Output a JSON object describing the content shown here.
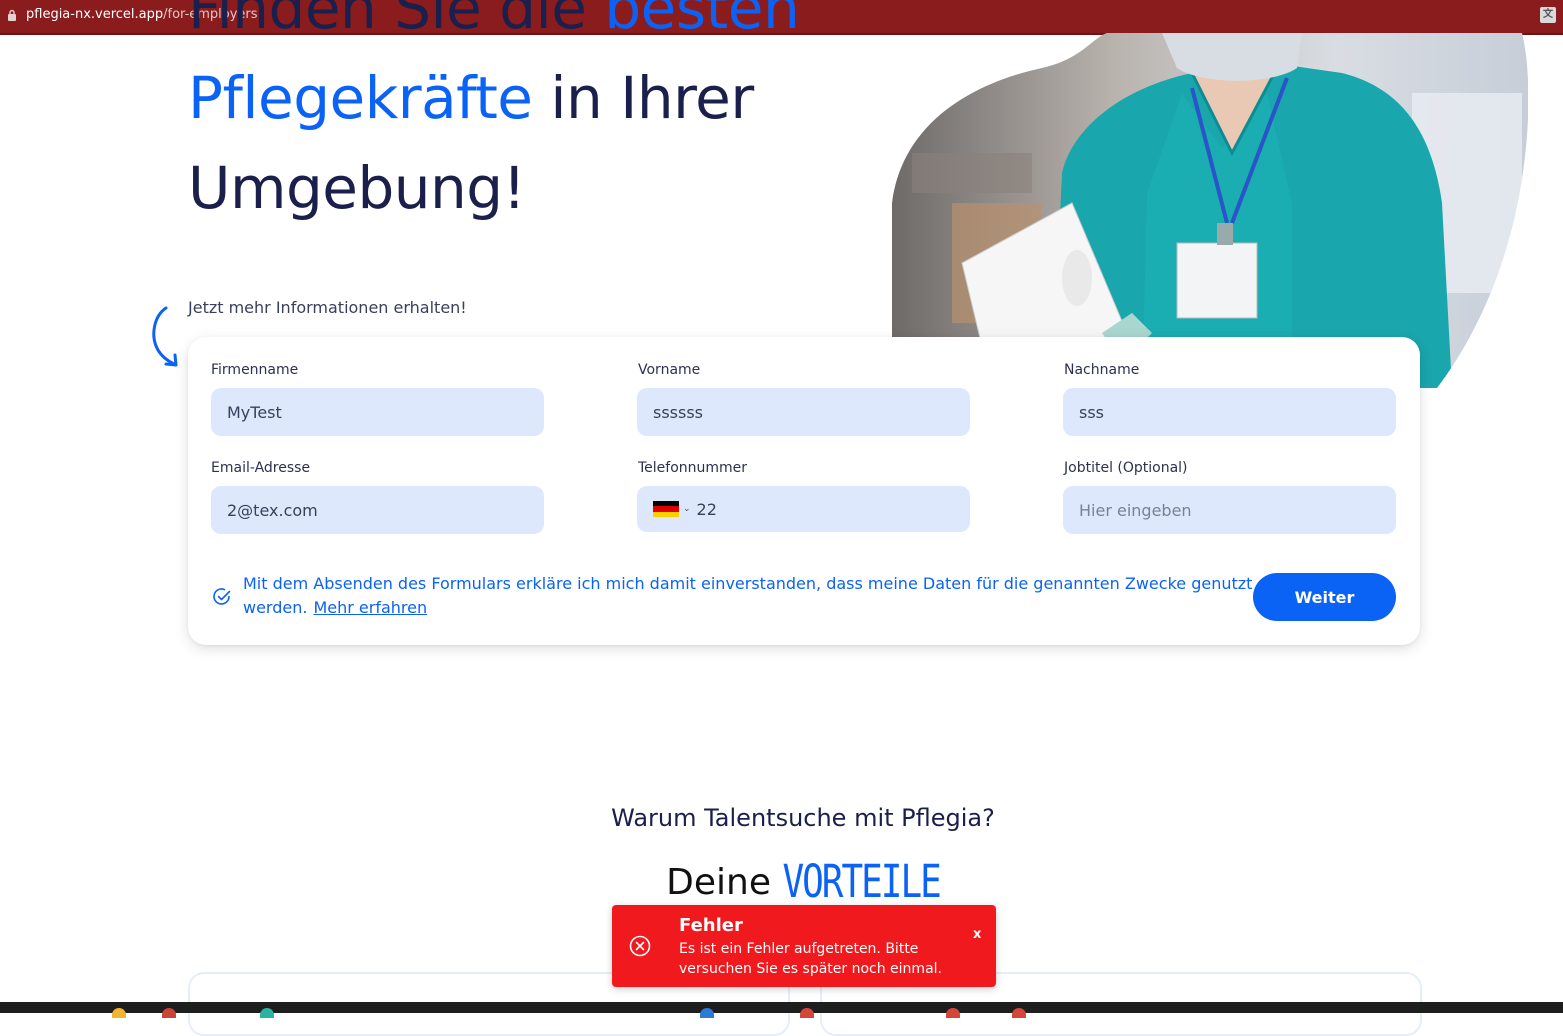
{
  "browser": {
    "url_host": "pflegia-nx.vercel.app",
    "url_path": "/for-employers"
  },
  "hero": {
    "line1_dark": "Finden Sie die ",
    "line1_blue": "besten",
    "line2_blue": "Pflegekräfte",
    "line2_dark": " in Ihrer",
    "line3_dark": "Umgebung!"
  },
  "subhead": "Jetzt mehr Informationen erhalten!",
  "form": {
    "firmenname": {
      "label": "Firmenname",
      "value": "MyTest"
    },
    "vorname": {
      "label": "Vorname",
      "value": "ssssss"
    },
    "nachname": {
      "label": "Nachname",
      "value": "sss"
    },
    "email": {
      "label": "Email-Adresse",
      "value": "2@tex.com"
    },
    "telefon": {
      "label": "Telefonnummer",
      "value": "22",
      "country": "DE"
    },
    "jobtitel": {
      "label": "Jobtitel (Optional)",
      "placeholder": "Hier eingeben"
    },
    "consent_text": "Mit dem Absenden des Formulars erkläre ich mich damit einverstanden, dass meine Daten für die genannten Zwecke genutzt werden.",
    "consent_link": "Mehr erfahren",
    "submit_label": "Weiter"
  },
  "section": {
    "kicker": "Warum Talentsuche mit Pflegia?",
    "title_plain": "Deine ",
    "title_accent": "VORTEILE"
  },
  "toast": {
    "title": "Fehler",
    "message": "Es ist ein Fehler aufgetreten. Bitte versuchen Sie es später noch einmal.",
    "close_label": "x"
  },
  "colors": {
    "accent": "#0a63f4",
    "dark_text": "#1b1f4b",
    "input_bg": "#dde8fd",
    "error": "#f0191e",
    "urlbar": "#8a1c1e"
  }
}
